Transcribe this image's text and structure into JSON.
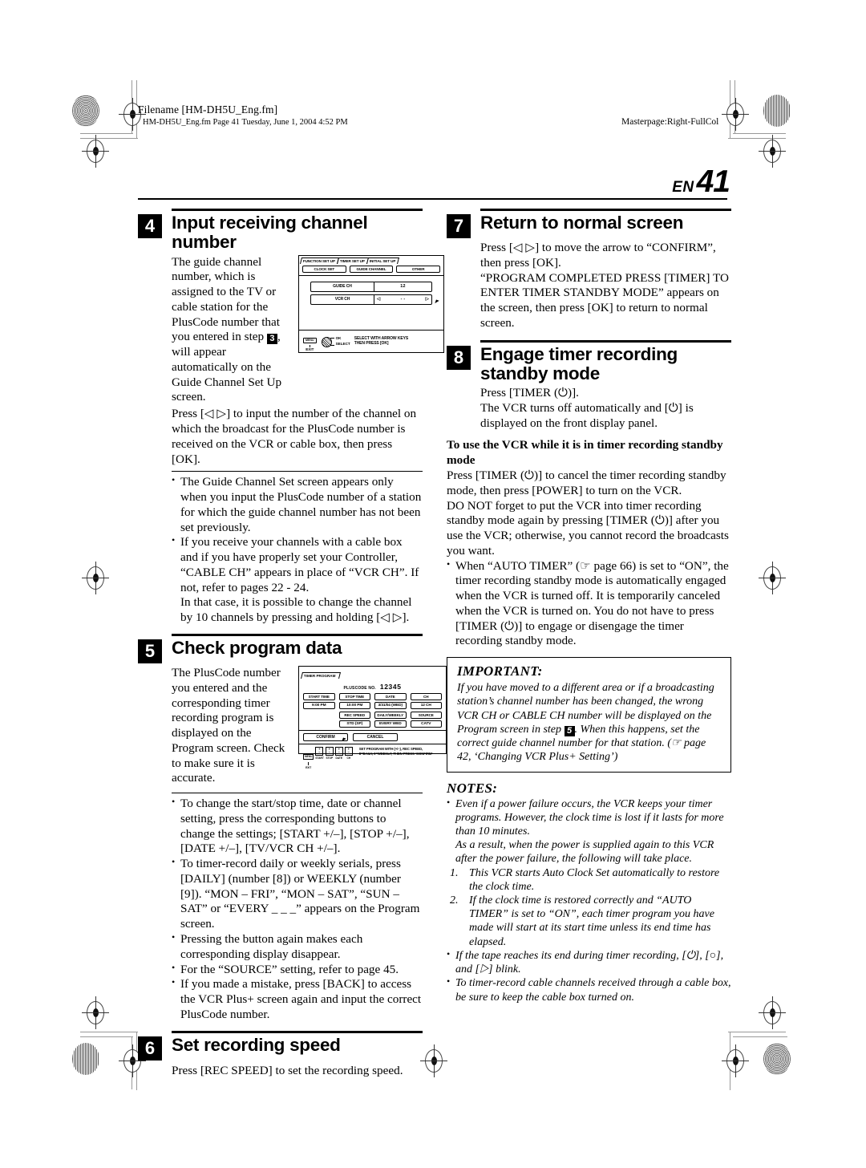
{
  "header": {
    "filename_label": "Filename [HM-DH5U_Eng.fm]",
    "file_sub": "HM-DH5U_Eng.fm  Page 41  Tuesday, June 1, 2004  4:52 PM",
    "masterpage": "Masterpage:Right-FullCol"
  },
  "page": {
    "lang_code": "EN",
    "number": "41"
  },
  "steps": {
    "s4": {
      "num": "4",
      "title": "Input receiving channel number",
      "intro": "The guide channel number, which is assigned to the TV or cable station for the PlusCode number that you entered in step",
      "intro_chip": "3",
      "intro_cont": ", will appear automatically on the Guide Channel Set Up screen.",
      "para2": "Press [◁ ▷] to input the number of the channel on which the broadcast for the PlusCode number is received on the VCR or cable box, then press [OK].",
      "bullets": [
        "The Guide Channel Set screen appears only when you input the PlusCode number of a station for which the guide channel number has not been set previously.",
        "If you receive your channels with a cable box and if you have properly set your Controller, “CABLE CH” appears in place of “VCR CH”. If not, refer to pages 22 - 24.\nIn that case, it is possible to change the channel by 10 channels by pressing and holding [◁ ▷]."
      ]
    },
    "s5": {
      "num": "5",
      "title": "Check program data",
      "intro": "The PlusCode number you entered and the corresponding timer recording program is displayed on the Program screen. Check to make sure it is accurate.",
      "bullets": [
        "To change the start/stop time, date or channel setting, press the corresponding buttons to change the settings;  [START +/–], [STOP +/–], [DATE +/–], [TV/VCR CH +/–].",
        "To timer-record daily or weekly serials, press [DAILY] (number [8]) or WEEKLY (number [9]). “MON – FRI”, “MON – SAT”, “SUN – SAT” or “EVERY _ _ _” appears on the Program screen.",
        "Pressing the button again makes each corresponding display disappear.",
        "For the “SOURCE” setting, refer to page 45.",
        "If you made a mistake, press [BACK] to access the VCR Plus+ screen again and input the correct PlusCode number."
      ]
    },
    "s6": {
      "num": "6",
      "title": "Set recording speed",
      "body": "Press [REC SPEED] to set the recording speed."
    },
    "s7": {
      "num": "7",
      "title": "Return to normal screen",
      "body": "Press [◁ ▷] to move the arrow to “CONFIRM”, then press [OK].\n“PROGRAM COMPLETED PRESS [TIMER] TO ENTER TIMER STANDBY MODE” appears on the screen, then press [OK] to return to normal screen."
    },
    "s8": {
      "num": "8",
      "title": "Engage timer recording standby mode",
      "body": "Press [TIMER (⏻)].\nThe VCR turns off automatically and [⏻] is displayed on the front display panel.",
      "sub_head": "To use the VCR while it is in timer recording standby mode",
      "sub_body": "Press [TIMER (⏻)] to cancel the timer recording standby mode, then press [POWER] to turn on the VCR.\nDO NOT forget to put the VCR into timer recording standby mode again by pressing [TIMER (⏻)] after you use the VCR; otherwise, you cannot record the broadcasts you want.",
      "sub_bullet": "When “AUTO TIMER” (☞ page 66) is set to “ON”, the timer recording standby mode is automatically engaged when the VCR is turned off. It is temporarily canceled when the VCR is turned on. You do not have to press [TIMER (⏻)] to engage or disengage the timer recording standby mode."
    }
  },
  "important": {
    "title": "IMPORTANT:",
    "body_a": "If you have moved to a different area or if a broadcasting station’s channel number has been changed, the wrong VCR CH or CABLE CH number will be displayed on the Program screen in step",
    "chip": "5",
    "body_b": ". When this happens, set the correct guide channel number for that station. (☞ page 42, ‘Changing VCR Plus+ Setting’)"
  },
  "notes": {
    "title": "NOTES:",
    "items": [
      "Even if a power failure occurs, the VCR keeps your timer programs. However, the clock time is lost if it lasts for more than 10 minutes.\nAs a result, when the power is supplied again to this VCR after the power failure, the following will take place.",
      "If the tape reaches its end during timer recording, [⏻], [○], and [▷] blink.",
      "To timer-record cable channels received through a cable box, be sure to keep the cable box turned on."
    ],
    "ordered": [
      {
        "n": "1.",
        "text": "This VCR starts Auto Clock Set automatically to restore the clock time."
      },
      {
        "n": "2.",
        "text": "If the clock time is restored correctly and “AUTO TIMER” is set to “ON”, each timer program you have made will start at its start time unless its end time has elapsed."
      }
    ]
  },
  "osd_guide": {
    "tabs": [
      "FUNCTION SET UP",
      "TIMER SET UP",
      "INITIAL SET UP"
    ],
    "selected_tab": "INITIAL SET UP",
    "subtabs": [
      "CLOCK SET",
      "GUIDE CHANNEL",
      "OTHER"
    ],
    "selected_subtab": "GUIDE CHANNEL",
    "rows": [
      {
        "label": "GUIDE CH",
        "value": "12",
        "arrows": false
      },
      {
        "label": "VCR CH",
        "value": "- -",
        "arrows": true
      }
    ],
    "footer": {
      "menu_label": "MENU",
      "exit_label": "EXIT",
      "ok_label": "OK",
      "select_label": "SELECT",
      "message_line1": "SELECT WITH ARROW KEYS",
      "message_line2": "THEN PRESS [OK]"
    }
  },
  "osd_timer": {
    "tab": "TIMER PROGRAM",
    "pluscode_label": "PLUSCODE NO.",
    "pluscode_value": "12345",
    "fields_row1": [
      {
        "label": "START TIME",
        "value": "9:00 PM"
      },
      {
        "label": "STOP TIME",
        "value": "10:00 PM"
      },
      {
        "label": "DATE",
        "value": "3/31/04 (WED)"
      },
      {
        "label": "CH",
        "value": "12 CH"
      }
    ],
    "fields_row2": [
      {
        "label": "REC SPEED",
        "value": "STD (SP)"
      },
      {
        "label": "DAILY/WEEKLY",
        "value": "EVERY WED"
      },
      {
        "label": "SOURCE",
        "value": "CATV"
      }
    ],
    "actions": [
      "CONFIRM",
      "CANCEL"
    ],
    "footer": {
      "keys": [
        "MENU",
        "START",
        "STOP",
        "DATE",
        "CH"
      ],
      "exit_label": "EXIT",
      "message_line1": "SET PROGRAM WITH (+/–), REC SPEED,",
      "message_line2": "8=DAILY, 9=WEEKLY; THEN PRESS ‘CONFIRM’"
    }
  },
  "colors": {
    "ink": "#000000",
    "paper": "#ffffff",
    "crop_mark": "#999999"
  }
}
